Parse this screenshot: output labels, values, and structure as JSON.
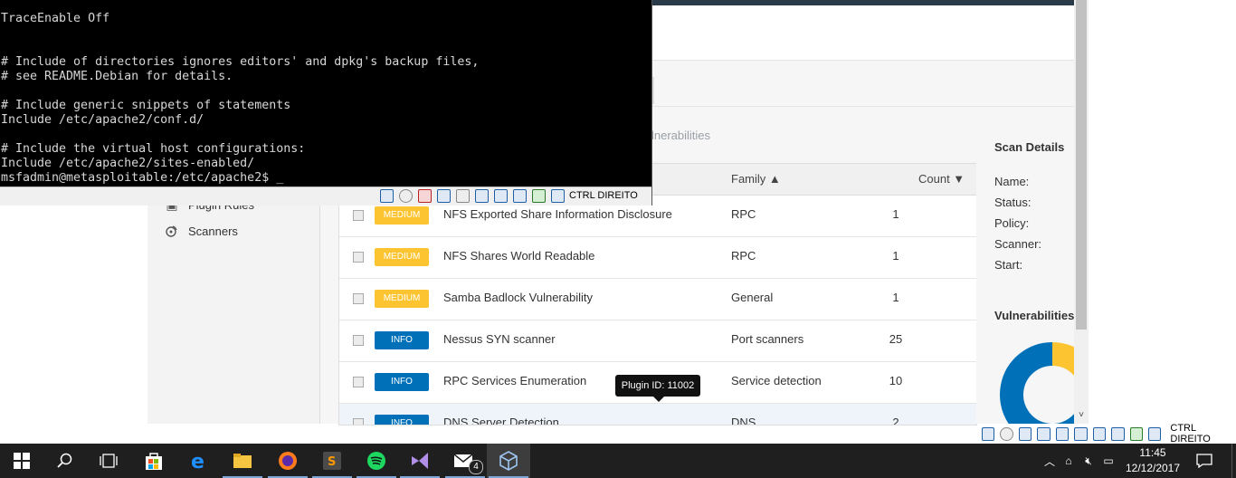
{
  "terminal": {
    "lines": [
      "TraceEnable Off",
      "",
      "",
      "# Include of directories ignores editors' and dpkg's backup files,",
      "# see README.Debian for details.",
      "",
      "# Include generic snippets of statements",
      "Include /etc/apache2/conf.d/",
      "",
      "# Include the virtual host configurations:",
      "Include /etc/apache2/sites-enabled/",
      "msfadmin@metasploitable:/etc/apache2$ _"
    ],
    "status_label": "CTRL DIREITO"
  },
  "sidebar": {
    "items": [
      {
        "label": "Plugin Rules",
        "icon": "plugin-rules-icon"
      },
      {
        "label": "Scanners",
        "icon": "scanners-icon"
      }
    ]
  },
  "tabs": {
    "vulnerabilities_partial": "lnerabilities"
  },
  "table": {
    "headers": {
      "family": "Family ▲",
      "count": "Count ▼"
    },
    "rows": [
      {
        "severity": "MEDIUM",
        "name": "NFS Exported Share Information Disclosure",
        "family": "RPC",
        "count": "1"
      },
      {
        "severity": "MEDIUM",
        "name": "NFS Shares World Readable",
        "family": "RPC",
        "count": "1"
      },
      {
        "severity": "MEDIUM",
        "name": "Samba Badlock Vulnerability",
        "family": "General",
        "count": "1"
      },
      {
        "severity": "INFO",
        "name": "Nessus SYN scanner",
        "family": "Port scanners",
        "count": "25"
      },
      {
        "severity": "INFO",
        "name": "RPC Services Enumeration",
        "family": "Service detection",
        "count": "10"
      },
      {
        "severity": "INFO",
        "name": "DNS Server Detection",
        "family": "DNS",
        "count": "2"
      }
    ]
  },
  "tooltip": {
    "text": "Plugin ID: 11002"
  },
  "scan_details": {
    "title": "Scan Details",
    "labels": [
      "Name:",
      "Status:",
      "Policy:",
      "Scanner:",
      "Start:"
    ],
    "vulnerabilities_title": "Vulnerabilities",
    "donut": {
      "info_fraction": 0.72,
      "medium_fraction": 0.28
    },
    "colors": {
      "info": "#0071b9",
      "medium": "#fdc431"
    }
  },
  "host_status": {
    "label": "CTRL DIREITO"
  },
  "taskbar": {
    "apps": [
      "start-icon",
      "search-icon",
      "task-view-icon",
      "store-icon",
      "edge-icon",
      "file-explorer-icon",
      "firefox-icon",
      "sublime-icon",
      "spotify-icon",
      "visual-studio-icon",
      "mail-icon",
      "virtualbox-icon"
    ],
    "mail_badge": "4",
    "clock_time": "11:45",
    "clock_date": "12/12/2017"
  }
}
